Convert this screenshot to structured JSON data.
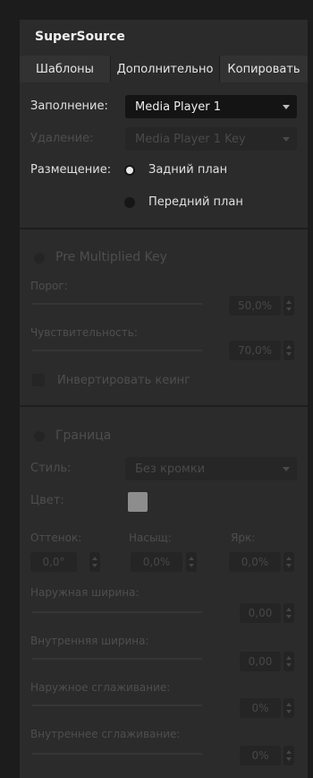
{
  "header": {
    "title": "SuperSource"
  },
  "tabs": [
    {
      "label": "Шаблоны"
    },
    {
      "label": "Дополнительно"
    },
    {
      "label": "Копировать"
    }
  ],
  "fill": {
    "label": "Заполнение:",
    "value": "Media Player 1"
  },
  "cut": {
    "label": "Удаление:",
    "value": "Media Player 1 Key"
  },
  "placement": {
    "label": "Размещение:",
    "options": [
      {
        "label": "Задний план",
        "selected": true
      },
      {
        "label": "Передний план",
        "selected": false
      }
    ]
  },
  "premultiplied": {
    "label": "Pre Multiplied Key",
    "clip_label": "Порог:",
    "clip_value": "50,0%",
    "gain_label": "Чувствительность:",
    "gain_value": "70,0%",
    "invert_label": "Инвертировать кеинг"
  },
  "border": {
    "label": "Граница",
    "style_label": "Стиль:",
    "style_value": "Без кромки",
    "color_label": "Цвет:",
    "hue_label": "Оттенок:",
    "hue_value": "0,0°",
    "sat_label": "Насыщ:",
    "sat_value": "0,0%",
    "lum_label": "Ярк:",
    "lum_value": "0,0%",
    "outer_width_label": "Наружная ширина:",
    "outer_width_value": "0,00",
    "inner_width_label": "Внутренняя ширина:",
    "inner_width_value": "0,00",
    "outer_soft_label": "Наружное сглаживание:",
    "outer_soft_value": "0%",
    "inner_soft_label": "Внутреннее сглаживание:",
    "inner_soft_value": "0%"
  }
}
